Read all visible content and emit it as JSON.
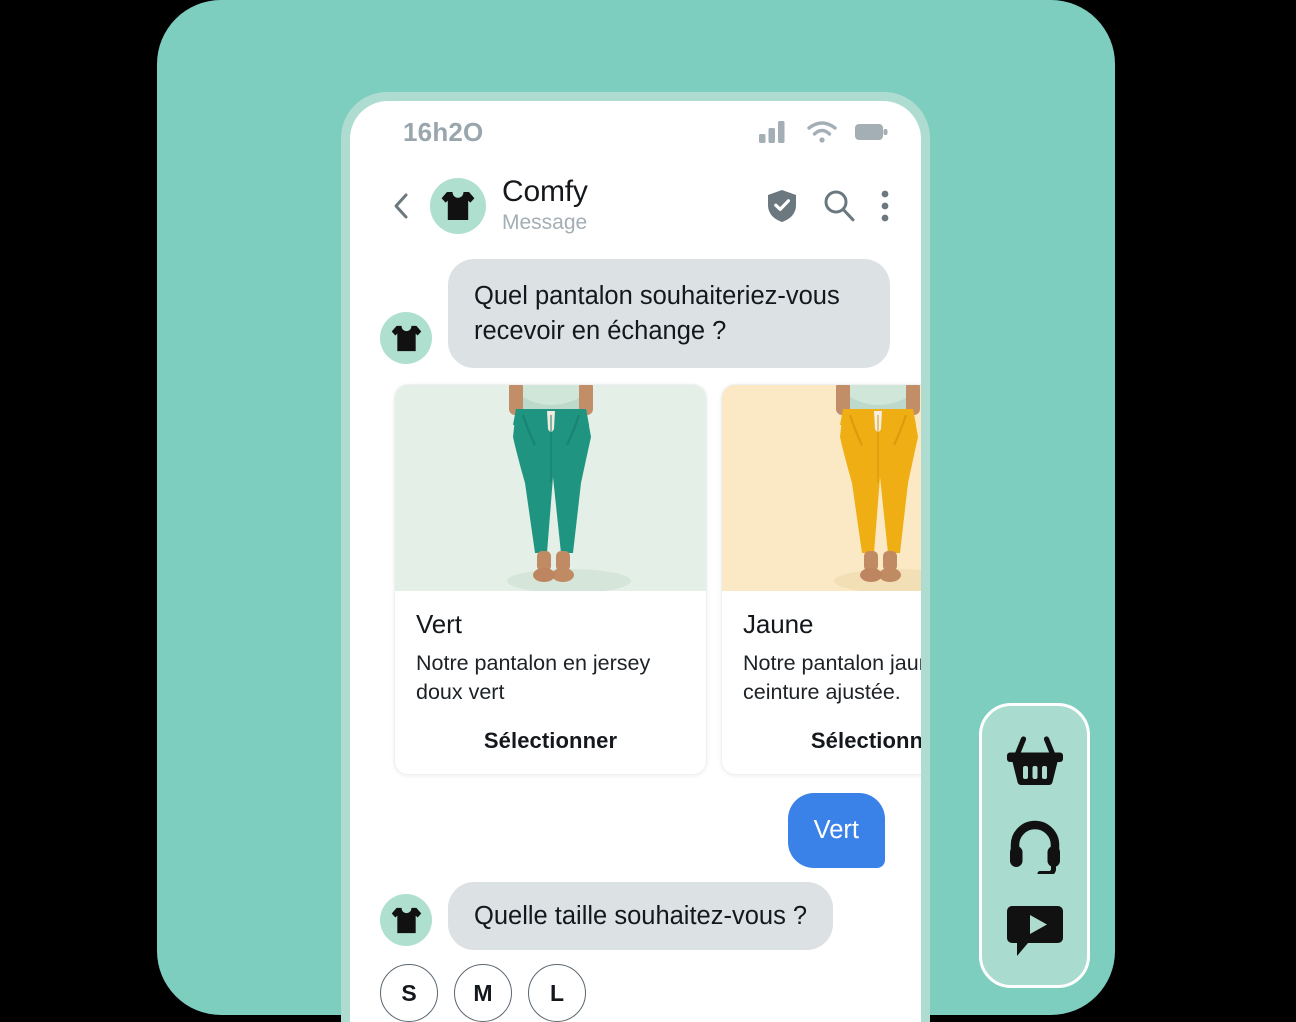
{
  "theme": {
    "backdrop_mint": "#7ECEBF",
    "phone_frame_mint": "#AFDCD1",
    "avatar_mint": "#AFDFCE",
    "bubble_gray": "#DCE1E4",
    "bubble_blue": "#3B82E8",
    "card_green_bg": "#E4EFE7",
    "card_yellow_bg": "#FBE8C4",
    "icon_gray": "#6B7880",
    "status_gray": "#A3AEB5",
    "sidebar_mint": "#A9DCCF"
  },
  "status_bar": {
    "time": "16h2O",
    "icons": [
      "signal-icon",
      "wifi-icon",
      "battery-icon"
    ]
  },
  "chat_header": {
    "back_icon": "chevron-left-icon",
    "avatar_icon": "tshirt-icon",
    "title": "Comfy",
    "subtitle": "Message",
    "actions": [
      "shield-check-icon",
      "search-icon",
      "more-vertical-icon"
    ]
  },
  "conversation": [
    {
      "sender": "bot",
      "avatar_icon": "tshirt-icon",
      "text": "Quel pantalon souhaiteriez-vous recevoir en échange ?"
    },
    {
      "sender": "user",
      "text": "Vert"
    },
    {
      "sender": "bot",
      "avatar_icon": "tshirt-icon",
      "text": "Quelle taille souhaitez-vous ?"
    }
  ],
  "product_carousel": {
    "cards": [
      {
        "title": "Vert",
        "description": "Notre pantalon en jersey doux vert",
        "cta": "Sélectionner",
        "image_alt": "green-pants-photo",
        "pants_color": "#1F9480",
        "background": "#E4EFE7"
      },
      {
        "title": "Jaune",
        "description": "Notre pantalon jaune à ceinture ajustée.",
        "cta": "Sélectionner",
        "image_alt": "yellow-pants-photo",
        "pants_color": "#EFAE14",
        "background": "#FBE8C4"
      }
    ]
  },
  "size_options": [
    "S",
    "M",
    "L"
  ],
  "floating_sidebar": {
    "buttons": [
      {
        "icon": "shopping-basket-icon",
        "name": "basket"
      },
      {
        "icon": "headset-icon",
        "name": "support"
      },
      {
        "icon": "chat-play-icon",
        "name": "video-chat"
      }
    ]
  }
}
